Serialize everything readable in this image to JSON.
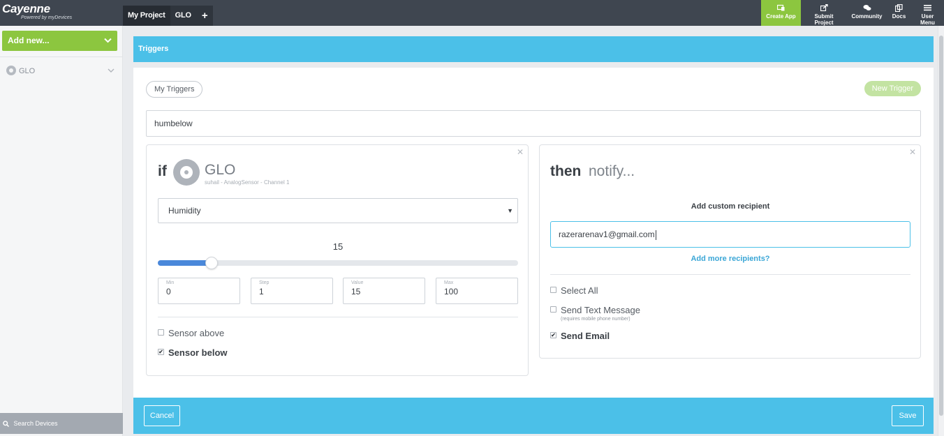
{
  "brand": {
    "name": "Cayenne",
    "tagline": "Powered by myDevices"
  },
  "project_tabs": [
    {
      "label": "My Project"
    },
    {
      "label": "GLO"
    },
    {
      "label": "+"
    }
  ],
  "nav": {
    "create_app": "Create App",
    "submit_project": "Submit Project",
    "community": "Community",
    "docs": "Docs",
    "user_menu": "User Menu"
  },
  "sidebar": {
    "add_new": "Add new...",
    "device": "GLO",
    "search": "Search Devices"
  },
  "page_header": "Triggers",
  "toolbar": {
    "my_triggers": "My Triggers",
    "new_trigger": "New Trigger"
  },
  "trigger_name": "humbelow",
  "if_card": {
    "if_label": "if",
    "device_name": "GLO",
    "device_sub": "suhail -  AnalogSensor -  Channel 1",
    "sensor_select": "Humidity",
    "slider": {
      "value": "15",
      "fraction": 0.15
    },
    "fields": [
      {
        "label": "Min",
        "value": "0"
      },
      {
        "label": "Step",
        "value": "1"
      },
      {
        "label": "Value",
        "value": "15"
      },
      {
        "label": "Max",
        "value": "100"
      }
    ],
    "sensor_above": "Sensor above",
    "sensor_below": "Sensor below"
  },
  "then_card": {
    "then_label": "then",
    "notify_label": "notify...",
    "add_custom_recipient": "Add custom recipient",
    "email": "razerarenav1@gmail.com",
    "add_more": "Add more recipients?",
    "select_all": "Select All",
    "send_text": "Send Text Message",
    "send_text_sub": "(requires mobile phone number)",
    "send_email": "Send Email"
  },
  "footer": {
    "cancel": "Cancel",
    "save": "Save"
  },
  "colors": {
    "topbar": "#3f4650",
    "accent_green": "#8cc63f",
    "accent_blue": "#4bc0e8",
    "slider_fill": "#4a88da"
  },
  "icons": {
    "create_app": "create-app-icon",
    "submit_project": "share-icon",
    "community": "chat-bubbles-icon",
    "docs": "docs-icon",
    "user_menu": "hamburger-menu-icon",
    "search": "search-icon",
    "close": "close-icon"
  }
}
